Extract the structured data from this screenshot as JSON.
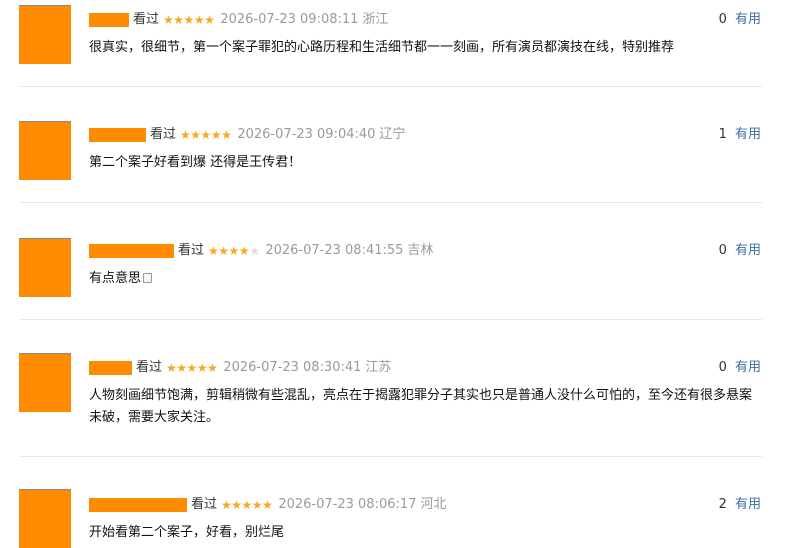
{
  "comments": [
    {
      "watched_label": "看过",
      "rating": 5,
      "max_rating": 5,
      "time": "2026-07-23 09:08:11",
      "region": "浙江",
      "useful_count": "0",
      "useful_label": "有用",
      "text": "很真实，很细节，第一个案子罪犯的心路历程和生活细节都一一刻画，所有演员都演技在线，特别推荐",
      "has_emoji": false
    },
    {
      "watched_label": "看过",
      "rating": 5,
      "max_rating": 5,
      "time": "2026-07-23 09:04:40",
      "region": "辽宁",
      "useful_count": "1",
      "useful_label": "有用",
      "text": "第二个案子好看到爆 还得是王传君！",
      "has_emoji": false
    },
    {
      "watched_label": "看过",
      "rating": 4,
      "max_rating": 5,
      "time": "2026-07-23 08:41:55",
      "region": "吉林",
      "useful_count": "0",
      "useful_label": "有用",
      "text": "有点意思",
      "has_emoji": true
    },
    {
      "watched_label": "看过",
      "rating": 5,
      "max_rating": 5,
      "time": "2026-07-23 08:30:41",
      "region": "江苏",
      "useful_count": "0",
      "useful_label": "有用",
      "text": "人物刻画细节饱满，剪辑稍微有些混乱，亮点在于揭露犯罪分子其实也只是普通人没什么可怕的，至今还有很多悬案未破，需要大家关注。",
      "has_emoji": false
    },
    {
      "watched_label": "看过",
      "rating": 5,
      "max_rating": 5,
      "time": "2026-07-23 08:06:17",
      "region": "河北",
      "useful_count": "2",
      "useful_label": "有用",
      "text": "开始看第二个案子，好看，别烂尾",
      "has_emoji": false
    }
  ],
  "colors": {
    "redaction": "#ff8c00",
    "star_filled": "#f7a823",
    "star_empty": "#dddddd",
    "meta_gray": "#9a9a9a",
    "useful_link": "#3a6ea5"
  }
}
